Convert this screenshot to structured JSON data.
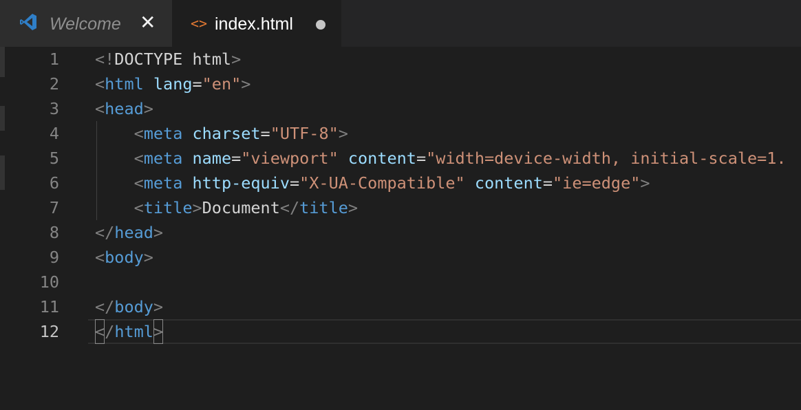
{
  "tabs": [
    {
      "label": "Welcome",
      "icon": "vscode-logo-icon",
      "state": "inactive",
      "close_glyph": "✕"
    },
    {
      "label": "index.html",
      "icon": "html-file-icon",
      "icon_glyph": "<>",
      "state": "active",
      "modified": true
    }
  ],
  "editor": {
    "active_line": 12,
    "line_numbers": [
      "1",
      "2",
      "3",
      "4",
      "5",
      "6",
      "7",
      "8",
      "9",
      "10",
      "11",
      "12"
    ],
    "lines": [
      [
        {
          "t": "punc",
          "v": "<!"
        },
        {
          "t": "text",
          "v": "DOCTYPE html"
        },
        {
          "t": "punc",
          "v": ">"
        }
      ],
      [
        {
          "t": "punc",
          "v": "<"
        },
        {
          "t": "tag",
          "v": "html"
        },
        {
          "t": "text",
          "v": " "
        },
        {
          "t": "attr",
          "v": "lang"
        },
        {
          "t": "eq",
          "v": "="
        },
        {
          "t": "str",
          "v": "\"en\""
        },
        {
          "t": "punc",
          "v": ">"
        }
      ],
      [
        {
          "t": "punc",
          "v": "<"
        },
        {
          "t": "tag",
          "v": "head"
        },
        {
          "t": "punc",
          "v": ">"
        }
      ],
      [
        {
          "t": "text",
          "v": "    "
        },
        {
          "t": "punc",
          "v": "<"
        },
        {
          "t": "tag",
          "v": "meta"
        },
        {
          "t": "text",
          "v": " "
        },
        {
          "t": "attr",
          "v": "charset"
        },
        {
          "t": "eq",
          "v": "="
        },
        {
          "t": "str",
          "v": "\"UTF-8\""
        },
        {
          "t": "punc",
          "v": ">"
        }
      ],
      [
        {
          "t": "text",
          "v": "    "
        },
        {
          "t": "punc",
          "v": "<"
        },
        {
          "t": "tag",
          "v": "meta"
        },
        {
          "t": "text",
          "v": " "
        },
        {
          "t": "attr",
          "v": "name"
        },
        {
          "t": "eq",
          "v": "="
        },
        {
          "t": "str",
          "v": "\"viewport\""
        },
        {
          "t": "text",
          "v": " "
        },
        {
          "t": "attr",
          "v": "content"
        },
        {
          "t": "eq",
          "v": "="
        },
        {
          "t": "str",
          "v": "\"width=device-width, initial-scale=1."
        }
      ],
      [
        {
          "t": "text",
          "v": "    "
        },
        {
          "t": "punc",
          "v": "<"
        },
        {
          "t": "tag",
          "v": "meta"
        },
        {
          "t": "text",
          "v": " "
        },
        {
          "t": "attr",
          "v": "http-equiv"
        },
        {
          "t": "eq",
          "v": "="
        },
        {
          "t": "str",
          "v": "\"X-UA-Compatible\""
        },
        {
          "t": "text",
          "v": " "
        },
        {
          "t": "attr",
          "v": "content"
        },
        {
          "t": "eq",
          "v": "="
        },
        {
          "t": "str",
          "v": "\"ie=edge\""
        },
        {
          "t": "punc",
          "v": ">"
        }
      ],
      [
        {
          "t": "text",
          "v": "    "
        },
        {
          "t": "punc",
          "v": "<"
        },
        {
          "t": "tag",
          "v": "title"
        },
        {
          "t": "punc",
          "v": ">"
        },
        {
          "t": "text",
          "v": "Document"
        },
        {
          "t": "punc",
          "v": "</"
        },
        {
          "t": "tag",
          "v": "title"
        },
        {
          "t": "punc",
          "v": ">"
        }
      ],
      [
        {
          "t": "punc",
          "v": "</"
        },
        {
          "t": "tag",
          "v": "head"
        },
        {
          "t": "punc",
          "v": ">"
        }
      ],
      [
        {
          "t": "punc",
          "v": "<"
        },
        {
          "t": "tag",
          "v": "body"
        },
        {
          "t": "punc",
          "v": ">"
        }
      ],
      [],
      [
        {
          "t": "punc",
          "v": "</"
        },
        {
          "t": "tag",
          "v": "body"
        },
        {
          "t": "punc",
          "v": ">"
        }
      ],
      [
        {
          "t": "punc",
          "v": "<",
          "box": true
        },
        {
          "t": "punc",
          "v": "/"
        },
        {
          "t": "tag",
          "v": "html"
        },
        {
          "t": "punc",
          "v": ">",
          "box": true
        }
      ]
    ]
  },
  "colors": {
    "background": "#1e1e1e",
    "tab_bar": "#252526",
    "tag": "#569cd6",
    "attribute": "#9cdcfe",
    "string": "#ce9178",
    "punctuation": "#808080",
    "text": "#d4d4d4",
    "html_icon": "#e37933"
  }
}
